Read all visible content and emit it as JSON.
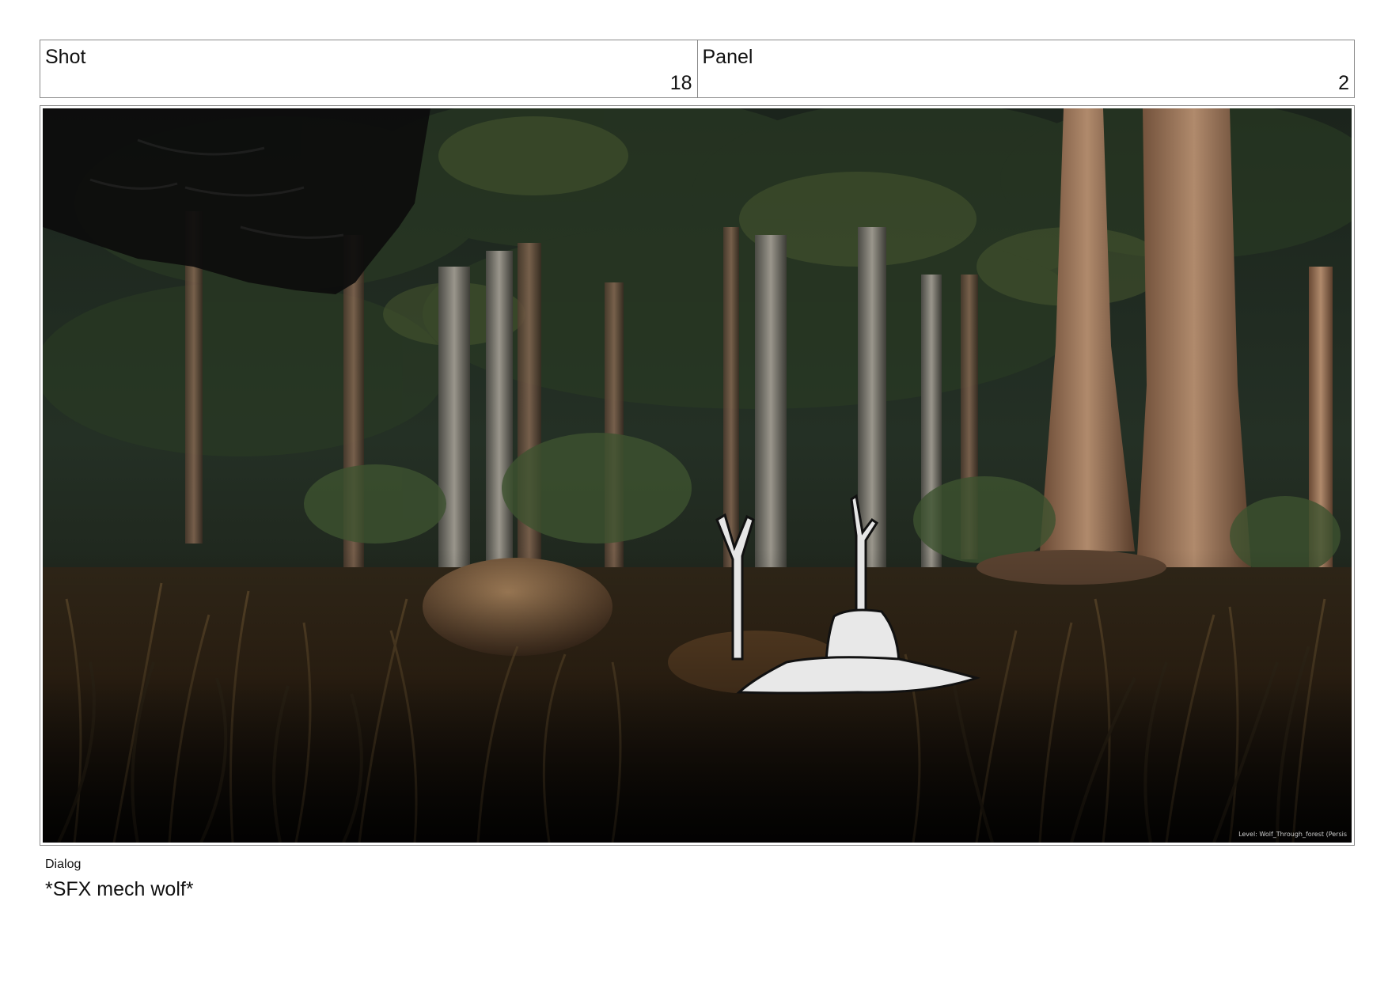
{
  "header": {
    "shot_label": "Shot",
    "shot_number": "18",
    "panel_label": "Panel",
    "panel_number": "2"
  },
  "frame": {
    "overlay_text": "Level:  Wolf_Through_forest (Persis"
  },
  "dialog": {
    "label": "Dialog",
    "text": "*SFX mech wolf*"
  }
}
